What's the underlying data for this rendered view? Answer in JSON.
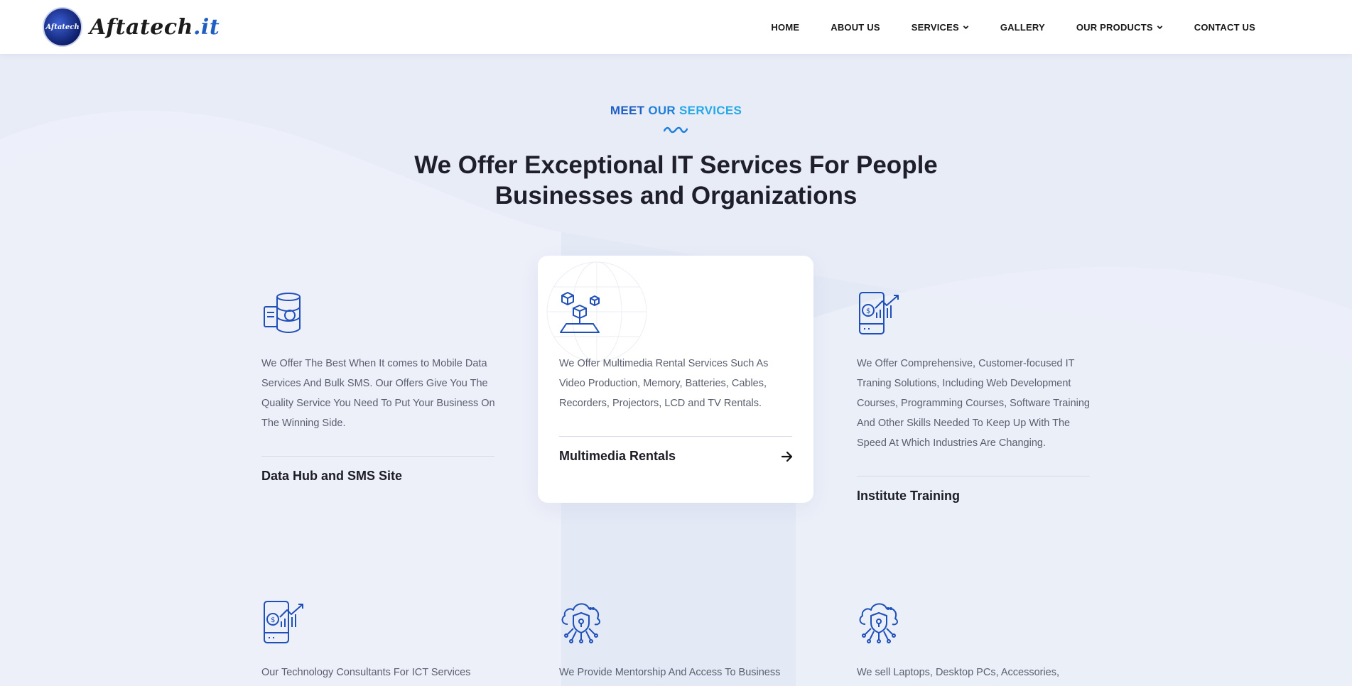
{
  "header": {
    "logo_badge_text": "Aftatech",
    "logo_text": "Aftatech",
    "logo_tld": ".it",
    "nav": [
      {
        "label": "HOME",
        "has_dropdown": false
      },
      {
        "label": "ABOUT US",
        "has_dropdown": false
      },
      {
        "label": "SERVICES",
        "has_dropdown": true
      },
      {
        "label": "GALLERY",
        "has_dropdown": false
      },
      {
        "label": "OUR PRODUCTS",
        "has_dropdown": true
      },
      {
        "label": "CONTACT US",
        "has_dropdown": false
      }
    ]
  },
  "section": {
    "eyebrow_1": "MEET",
    "eyebrow_2": "OUR",
    "eyebrow_3": "SERVICES",
    "headline_line1": "We Offer Exceptional IT Services For People",
    "headline_line2": "Businesses and Organizations"
  },
  "services": [
    {
      "icon": "database-icon",
      "description": "We Offer The Best When It comes to Mobile Data Services And Bulk SMS. Our Offers Give You The Quality Service You Need To Put Your Business On The Winning Side.",
      "title": "Data Hub and SMS Site"
    },
    {
      "icon": "boxes-icon",
      "description": "We Offer Multimedia Rental Services Such As Video Production, Memory, Batteries, Cables, Recorders, Projectors, LCD and TV Rentals.",
      "title": "Multimedia Rentals"
    },
    {
      "icon": "mobile-finance-icon",
      "description": "We Offer Comprehensive, Customer-focused IT Traning Solutions, Including Web Development Courses, Programming Courses, Software Training And Other Skills Needed To Keep Up With The Speed At Which Industries Are Changing.",
      "title": "Institute Training"
    },
    {
      "icon": "mobile-finance-icon",
      "description": "Our Technology Consultants For ICT Services"
    },
    {
      "icon": "cloud-security-icon",
      "description": "We Provide Mentorship And Access To Business"
    },
    {
      "icon": "cloud-security-icon",
      "description": "We sell Laptops, Desktop PCs, Accessories,"
    }
  ],
  "colors": {
    "primary": "#1f5fc4",
    "accent": "#27a9e8",
    "background": "#e8ecf7",
    "heading": "#1f1f2b",
    "body_text": "#5a5f6e"
  }
}
